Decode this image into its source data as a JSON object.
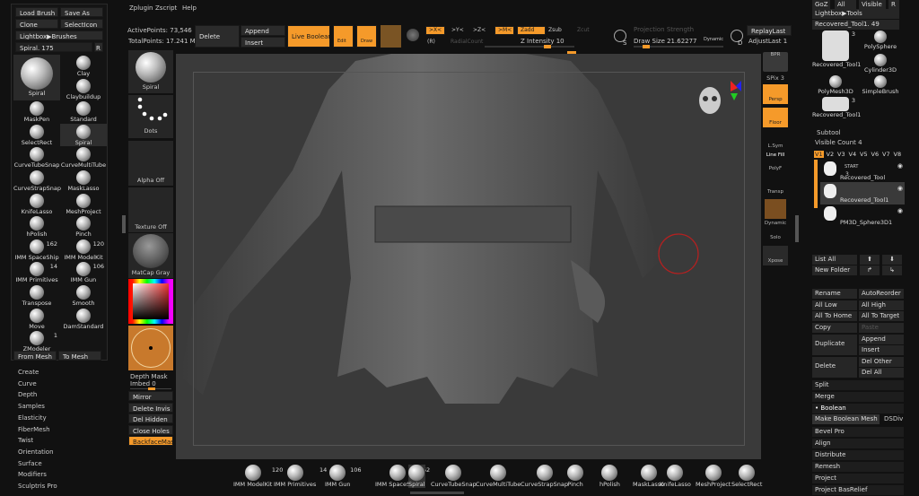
{
  "menubar": [
    "Zplugin",
    "Zscript",
    "Help"
  ],
  "stats": {
    "active_points": "ActivePoints: 73,546",
    "total_points": "TotalPoints: 17.241 Mil"
  },
  "toolbar": {
    "delete": "Delete",
    "append": "Append",
    "insert": "Insert",
    "live_boolean": "Live Boolean",
    "edit": "Edit",
    "draw": "Draw",
    "sym_x": ">X<",
    "sym_y": ">Y<",
    "sym_z": ">Z<",
    "sym_r": "(R)",
    "radial_count": "RadialCount",
    "sym_m": ">M<",
    "zadd": "Zadd",
    "zsub": "Zsub",
    "zcut": "Zcut",
    "z_intensity": "Z Intensity 10",
    "projection_strength": "Projection Strength",
    "draw_size": "Draw Size 21.62277",
    "dynamic": "Dynamic",
    "replay_last": "ReplayLast",
    "adjust_last": "AdjustLast 1",
    "s_label": "S",
    "d_label": "D"
  },
  "left_palette": {
    "load_brush": "Load Brush",
    "save_as": "Save As",
    "clone": "Clone",
    "select_icon": "SelectIcon",
    "lightbox_brushes": "Lightbox▶Brushes",
    "current": "Spiral. 175",
    "r": "R",
    "brushes": [
      {
        "name": "Spiral",
        "big": true
      },
      {
        "name": "Clay"
      },
      {
        "name": "Claybuildup"
      },
      {
        "name": "MaskPen"
      },
      {
        "name": "Standard"
      },
      {
        "name": "SelectRect"
      },
      {
        "name": "Spiral",
        "sel": true
      },
      {
        "name": "CurveTubeSnap"
      },
      {
        "name": "CurveMultiTube"
      },
      {
        "name": "CurveStrapSnap"
      },
      {
        "name": "MaskLasso"
      },
      {
        "name": "KnifeLasso"
      },
      {
        "name": "MeshProject"
      },
      {
        "name": "hPolish"
      },
      {
        "name": "Pinch"
      },
      {
        "name": "IMM SpaceShip",
        "count": "162"
      },
      {
        "name": "IMM ModelKit",
        "count": "120"
      },
      {
        "name": "IMM Primitives",
        "count": "14"
      },
      {
        "name": "IMM Gun",
        "count": "106"
      },
      {
        "name": "Transpose"
      },
      {
        "name": "Smooth"
      },
      {
        "name": "Move"
      },
      {
        "name": "DamStandard"
      },
      {
        "name": "ZModeler",
        "count": "1"
      }
    ],
    "from_mesh": "From Mesh",
    "to_mesh": "To Mesh"
  },
  "left_menu": [
    "Create",
    "Curve",
    "Depth",
    "Samples",
    "Elasticity",
    "FiberMesh",
    "Twist",
    "Orientation",
    "Surface",
    "Modifiers",
    "Sculptris Pro"
  ],
  "shelf": {
    "brush": "Spiral",
    "stroke": "Dots",
    "alpha": "Alpha Off",
    "texture": "Texture Off",
    "material": "MatCap Gray",
    "depth_mask": "Depth Mask",
    "imbed": "Imbed 0",
    "mirror": "Mirror",
    "delete_invis": "Delete Invis",
    "del_hidden": "Del Hidden",
    "close_holes": "Close Holes",
    "backface_mask": "BackfaceMask"
  },
  "right_shelf": {
    "bpr": "BPR",
    "spix": "SPix 3",
    "persp": "Persp",
    "floor": "Floor",
    "lsym": "L.Sym",
    "line_fill": "Line Fill",
    "polyf": "PolyF",
    "transp": "Transp",
    "dynamic": "Dynamic",
    "solo": "Solo",
    "xpose": "Xpose"
  },
  "right_palette": {
    "goz": "GoZ",
    "all": "All",
    "visible": "Visible",
    "r": "R",
    "lightbox_tools": "Lightbox▶Tools",
    "current_tool": "Recovered_Tool1. 49",
    "tools": [
      {
        "name": "Recovered_Tool1",
        "count": "3"
      },
      {
        "name": "PolySphere"
      },
      {
        "name": "Cylinder3D"
      },
      {
        "name": "PolyMesh3D"
      },
      {
        "name": "SimpleBrush"
      },
      {
        "name": "Recovered_Tool1",
        "count": "3"
      }
    ],
    "subtool": "Subtool",
    "visible_count": "Visible Count 4",
    "versions": [
      "V1",
      "V2",
      "V3",
      "V4",
      "V5",
      "V6",
      "V7",
      "V8"
    ],
    "subtools": [
      {
        "name": "Recovered_Tool",
        "count": "3",
        "note": "START"
      },
      {
        "name": "Recovered_Tool1"
      },
      {
        "name": "PM3D_Sphere3D1"
      }
    ],
    "list_all": "List All",
    "new_folder": "New Folder",
    "rename": "Rename",
    "auto_reorder": "AutoReorder",
    "all_low": "All Low",
    "all_high": "All High",
    "all_to_home": "All To Home",
    "all_to_target": "All To Target",
    "copy": "Copy",
    "paste": "Paste",
    "duplicate": "Duplicate",
    "append": "Append",
    "insert": "Insert",
    "delete": "Delete",
    "del_other": "Del Other",
    "del_all": "Del All",
    "split": "Split",
    "merge": "Merge",
    "boolean": "• Boolean",
    "make_boolean_mesh": "Make Boolean Mesh",
    "dsdiv": "DSDiv",
    "bevel_pro": "Bevel Pro",
    "align": "Align",
    "distribute": "Distribute",
    "remesh": "Remesh",
    "project": "Project",
    "project_basrelief": "Project BasRelief"
  },
  "bottom_shelf": [
    {
      "name": "IMM ModelKit",
      "count": "120"
    },
    {
      "name": "IMM Primitives",
      "count": "14"
    },
    {
      "name": "IMM Gun",
      "count": "106"
    },
    {
      "name": "IMM SpaceShip",
      "count": "162"
    },
    {
      "name": "Spiral"
    },
    {
      "name": "CurveTubeSnap"
    },
    {
      "name": "CurveMultiTube"
    },
    {
      "name": "CurveStrapSnap"
    },
    {
      "name": "Pinch"
    },
    {
      "name": "hPolish"
    },
    {
      "name": "MaskLasso"
    },
    {
      "name": "KnifeLasso"
    },
    {
      "name": "MeshProject"
    },
    {
      "name": "SelectRect"
    }
  ],
  "colors": {
    "accent": "#f59a2a",
    "canvas": "#3a3a3a"
  }
}
